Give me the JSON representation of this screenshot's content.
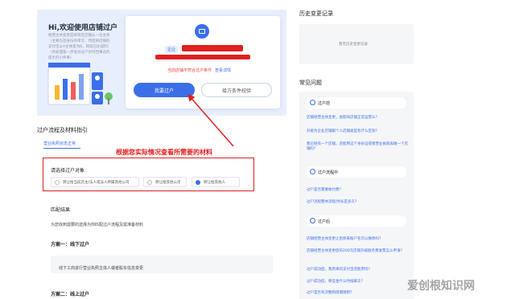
{
  "hero": {
    "title": "Hi,欢迎使用店铺过户",
    "description": "经营主体变更是将淘宝店铺从一位主体（主要包括身份的审写，然后将店铺的支付宝从A主体变为B，目前已达成的）（另处理第一步会对过户有时回事态的提示的小件事）"
  },
  "card": {
    "company_tag": "企业",
    "notice_text": "当前店铺不符合过户条件",
    "notice_link": "查看详情",
    "primary_button": "我要过户",
    "secondary_button": "接方条件校验"
  },
  "section": {
    "title": "过户流程及材料指引",
    "sub_tab": "营业执照状态正常",
    "red_caption": "根据您实际情况查看所需要的材料",
    "select_label": "请选择过户对象",
    "options": [
      {
        "label": "转让给当前店主/法人或法人所属其他公司",
        "selected": false
      },
      {
        "label": "转让给其他公司",
        "selected": false
      },
      {
        "label": "转让给其他人",
        "selected": true
      }
    ],
    "match_title": "匹配结果",
    "match_desc": "为您找到需要的选择为你匹配过户流程及需准备材料",
    "plan1_title": "方案一：线下过户",
    "plan1_text": "线下工商进行营业执照主体人或者股东信息变更",
    "plan2_title": "方案二：线上过户"
  },
  "right": {
    "history_title": "历史变更记录",
    "history_empty": "暂无历史变更记录",
    "faq_title": "常见问题",
    "groups": [
      {
        "label": "过户前",
        "links": [
          "店铺经营主体变更，会影响店铺正常运营么？",
          "升级为企业店铺跟个人店铺类型有什么区别？",
          "我已经有一个店铺，还能用这个身份证或者营业执照再做一个店铺吗？"
        ]
      },
      {
        "label": "过户流程中",
        "links": [
          "过户是否需要收付费？",
          "过户流程整体流程/时长是多久？"
        ]
      },
      {
        "label": "过户后",
        "links": [
          "店铺经营主体变更之后原来账户名可以换改吗？",
          "店铺经营主体变更后的200元店铺升级服务费发票怎么申请？",
          "过户成功后，我原来的支付宝还能用吗？",
          "过户成功后，保证金什么时候解冻？",
          "过户是否有次数和周期限制？"
        ]
      }
    ],
    "watermark": "爱创根知识网"
  },
  "colors": {
    "accent": "#3b6fe8",
    "annotation_red": "#e02020"
  }
}
